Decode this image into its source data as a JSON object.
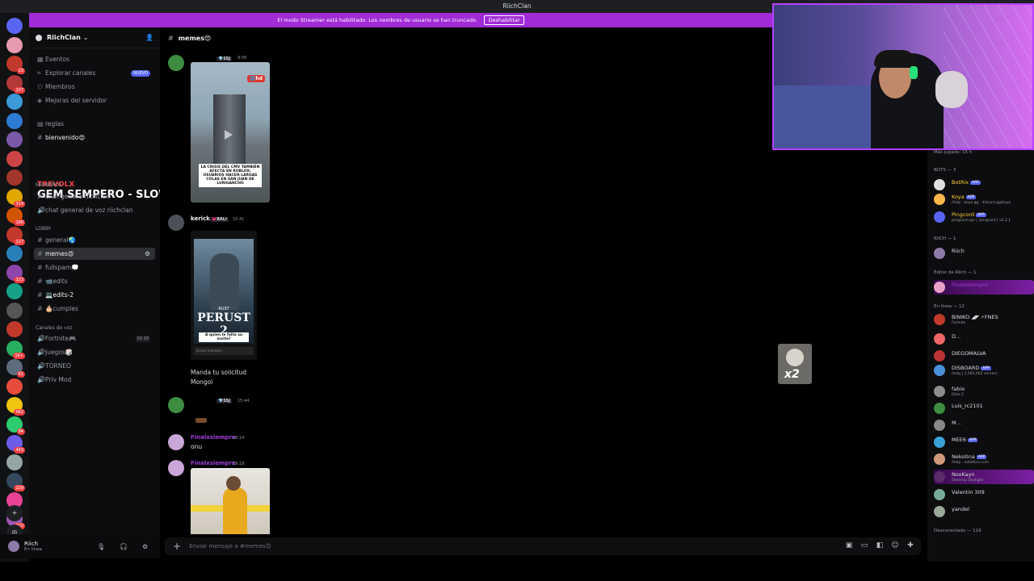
{
  "window": {
    "title": "RiichClan"
  },
  "banner": {
    "text": "El modo Streamer está habilitado. Los nombres de usuario se han truncado.",
    "button": "Deshabilitar"
  },
  "guilds": [
    {
      "color": "#5865f2",
      "badge": ""
    },
    {
      "color": "#e89bb0",
      "badge": ""
    },
    {
      "color": "#c0392b",
      "badge": "23"
    },
    {
      "color": "#b33939",
      "badge": "107"
    },
    {
      "color": "#3c9ad6",
      "badge": ""
    },
    {
      "color": "#2d7bd4",
      "badge": ""
    },
    {
      "color": "#7a5aa8",
      "badge": ""
    },
    {
      "color": "#c44",
      "badge": ""
    },
    {
      "color": "#a3362b",
      "badge": ""
    },
    {
      "color": "#e0a800",
      "badge": "314"
    },
    {
      "color": "#d35400",
      "badge": "166"
    },
    {
      "color": "#c0392b",
      "badge": "117"
    },
    {
      "color": "#2980b9",
      "badge": ""
    },
    {
      "color": "#8e44ad",
      "badge": "323"
    },
    {
      "color": "#16a085",
      "badge": ""
    },
    {
      "color": "#555",
      "badge": ""
    },
    {
      "color": "#c0392b",
      "badge": ""
    },
    {
      "color": "#27ae60",
      "badge": "1K+"
    },
    {
      "color": "#5d6d7e",
      "badge": "61"
    },
    {
      "color": "#e74c3c",
      "badge": ""
    },
    {
      "color": "#f1c40f",
      "badge": "962"
    },
    {
      "color": "#2ecc71",
      "badge": "84"
    },
    {
      "color": "#6c5ce7",
      "badge": "443"
    },
    {
      "color": "#95a5a6",
      "badge": ""
    },
    {
      "color": "#34495e",
      "badge": "229"
    },
    {
      "color": "#e84393",
      "badge": ""
    },
    {
      "color": "#9b59b6",
      "badge": "212"
    }
  ],
  "sidebar": {
    "server_name": "RiichClan",
    "top_items": [
      "Eventos",
      "Explorar canales",
      "Miembros",
      "Mejoras del servidor"
    ],
    "new_badge": "NUEVO",
    "channels": {
      "reglas": "reglas",
      "bienvenido": "bienvenido😍",
      "cat_miembros": "miembros",
      "chat_genera": "chat-genera-riichclan",
      "voz_general": "chat general de voz riichclan",
      "cat_lobby": "LOBBY",
      "general": "general🌏",
      "memes": "memes😍",
      "fullspam": "fullspam💭",
      "edits": "📹edits",
      "edits2": "💻edits-2",
      "cumples": "🎂cumples",
      "cat_voz": "Canales de voz",
      "fortnite": "Fortnite🎮",
      "fortnite_count": "00 29",
      "juegos": "Juegos🎲",
      "torneo": "TORNEO",
      "privmod": "Priv Mod"
    },
    "overlay": {
      "line1": "TREVOLX",
      "line2": "GEM SEMPERO - SLOW"
    }
  },
  "user": {
    "name": "Riich",
    "status": "En línea"
  },
  "chat": {
    "channel": "memes😍",
    "messages": [
      {
        "name": "",
        "tag": "💎SSJ",
        "time": "9:56",
        "image": {
          "logo": "🌐hd",
          "caption": "LA CRISIS DEL CMV TAMBIÉN AFECTA EN ROBLOX: USUARIOS HACEN LARGAS COLAS EN SAN JUAN DE LURIGANCHO"
        }
      },
      {
        "name": "kerick",
        "tag": "💗BALI",
        "time": "15:41",
        "image": {
          "t1": "RUST",
          "t2": "PERUST 2",
          "t3": "A quien le falta su invite?",
          "bar": "Enviar mensaje..."
        },
        "text1": "Manda tu solicitud",
        "text2": "Mongol"
      },
      {
        "name": "",
        "tag": "💎SSJ",
        "time": "15:44"
      },
      {
        "name": "Finalxsiempre",
        "time": "18:14",
        "text1": "onu"
      },
      {
        "name": "Finalxsiempre",
        "time": "19:18"
      }
    ]
  },
  "composer": {
    "placeholder": "Enviar mensaje a #memes😍",
    "icons": [
      "gift-icon",
      "gif-icon",
      "sticker-icon",
      "emoji-icon",
      "apps-icon"
    ]
  },
  "members": {
    "played": "Más jugado: 15 h",
    "cat_bots": "BOTS — 3",
    "cat_riich": "RIICH — 1",
    "cat_editor": "Editor de Riich — 1",
    "cat_online": "En línea — 12",
    "cat_offline": "Desconectado — 119",
    "app_label": "APP",
    "bots": [
      {
        "name": "BotRix",
        "sub": "",
        "color": "#ffd43b"
      },
      {
        "name": "Koya",
        "sub": "/help · koya.gg · discord.gg/koya",
        "color": "#ffd43b"
      },
      {
        "name": "Pingcord",
        "sub": "pingcord.xyz | !pingcord | v2.2.1",
        "color": "#ffd43b"
      }
    ],
    "riich": {
      "name": "Riich"
    },
    "editor": {
      "name": "Finalxsiempre"
    },
    "online": [
      {
        "name": "BINIKO ◢◤ ⚡FNES",
        "sub": "Fortnite"
      },
      {
        "name": "D...",
        "sub": ""
      },
      {
        "name": "DIEGOMALVA",
        "sub": ""
      },
      {
        "name": "DISBOARD",
        "sub": "/help | 1,562,002 servers",
        "app": true
      },
      {
        "name": "fabio",
        "sub": "Dota 2"
      },
      {
        "name": "Luis_rc2101",
        "sub": ""
      },
      {
        "name": "M...",
        "sub": ""
      },
      {
        "name": "MEE6",
        "sub": "",
        "app": true
      },
      {
        "name": "Nekotina",
        "sub": "/help · nekotina.com",
        "app": true
      },
      {
        "name": "NoxKayn",
        "sub": "Dead by Daylight"
      },
      {
        "name": "Valentin 309",
        "sub": ""
      },
      {
        "name": "yandel",
        "sub": ""
      }
    ]
  },
  "sticker": {
    "label": "x2"
  }
}
